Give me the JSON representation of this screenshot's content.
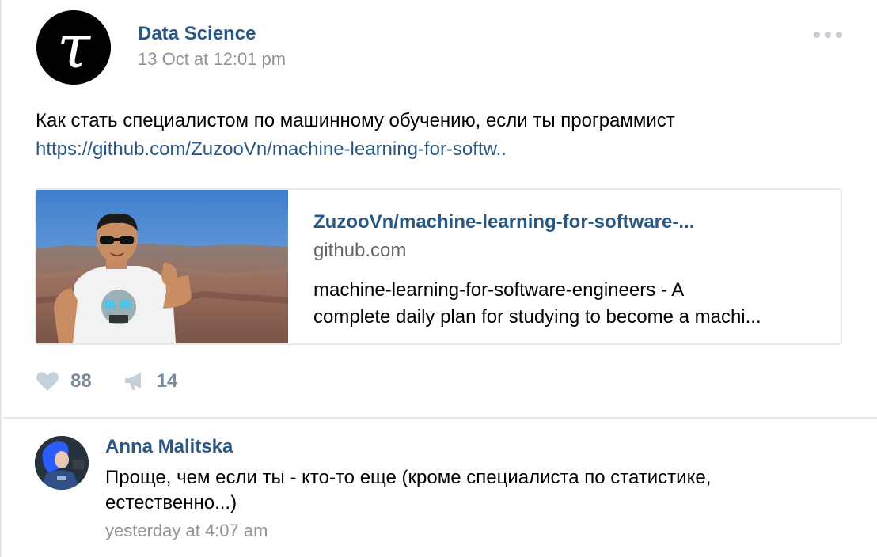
{
  "post": {
    "author": "Data Science",
    "date": "13 Oct at 12:01 pm",
    "text": "Как стать специалистом по машинному обучению, если ты программист",
    "link_text": "https://github.com/ZuzooVn/machine-learning-for-softw..",
    "more_icon": "more-horizontal-icon",
    "avatar_logo": "τ"
  },
  "card": {
    "title": "ZuzooVn/machine-learning-for-software-...",
    "domain": "github.com",
    "description_line1": "machine-learning-for-software-engineers - A",
    "description_line2": "complete daily plan for studying to become a machi..."
  },
  "actions": {
    "likes_count": "88",
    "reposts_count": "14",
    "like_icon": "heart-icon",
    "repost_icon": "megaphone-icon"
  },
  "comment": {
    "author": "Anna Malitska",
    "text_line1": "Проще, чем если ты - кто-то еще (кроме специалиста по статистике,",
    "text_line2": "естественно...)",
    "date": "yesterday at 4:07 am"
  },
  "colors": {
    "link": "#2a5885",
    "muted": "#939393",
    "action": "#7b8b9d",
    "border": "#e7e8ec"
  }
}
